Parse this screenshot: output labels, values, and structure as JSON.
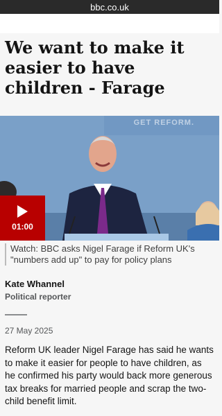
{
  "browser": {
    "url": "bbc.co.uk"
  },
  "article": {
    "headline": "We want to make it easier to have children - Farage",
    "video": {
      "duration": "01:00",
      "caption": "Watch: BBC asks Nigel Farage if Reform UK's \"numbers add up\" to pay for policy plans",
      "backdrop_text": "GET REFORM."
    },
    "author": {
      "name": "Kate Whannel",
      "role": "Political reporter"
    },
    "date": "27 May 2025",
    "body": "Reform UK leader Nigel Farage has said he wants to make it easier for people to have children, as he confirmed his party would back more generous tax breaks for married people and scrap the two-child benefit limit."
  },
  "colors": {
    "bbc_red": "#b80000",
    "url_bar": "#2a2a2a",
    "page_bg": "#f6f6f6"
  },
  "icons": {
    "play": "play-icon"
  }
}
